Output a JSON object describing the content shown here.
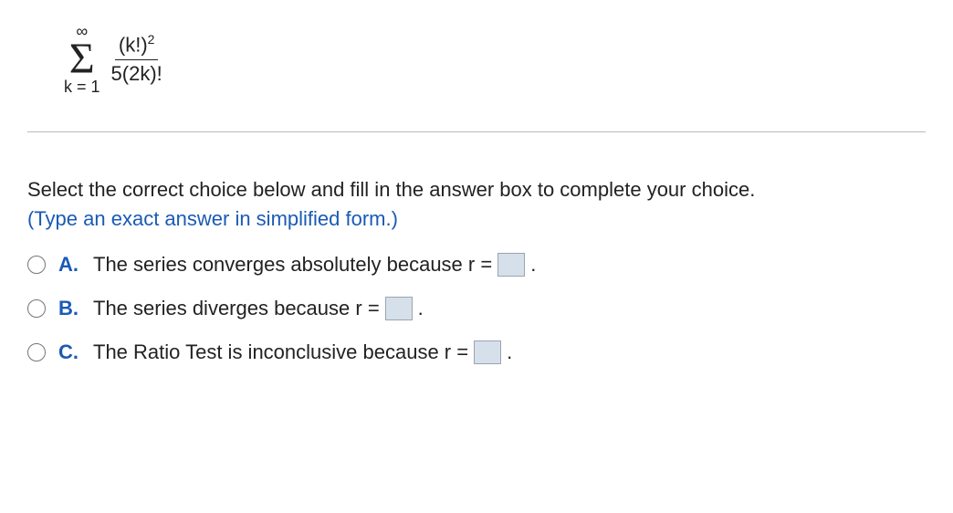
{
  "formula": {
    "upper": "∞",
    "sigma": "Σ",
    "lower": "k = 1",
    "numerator_base": "(k!)",
    "numerator_exp": "2",
    "denominator": "5(2k)!"
  },
  "instructions": "Select the correct choice below and fill in the answer box to complete your choice.",
  "hint": "(Type an exact answer in simplified form.)",
  "options": [
    {
      "letter": "A.",
      "text_pre": "The series converges absolutely because r =",
      "text_post": "."
    },
    {
      "letter": "B.",
      "text_pre": "The series diverges because r =",
      "text_post": "."
    },
    {
      "letter": "C.",
      "text_pre": "The Ratio Test is inconclusive because r =",
      "text_post": "."
    }
  ]
}
